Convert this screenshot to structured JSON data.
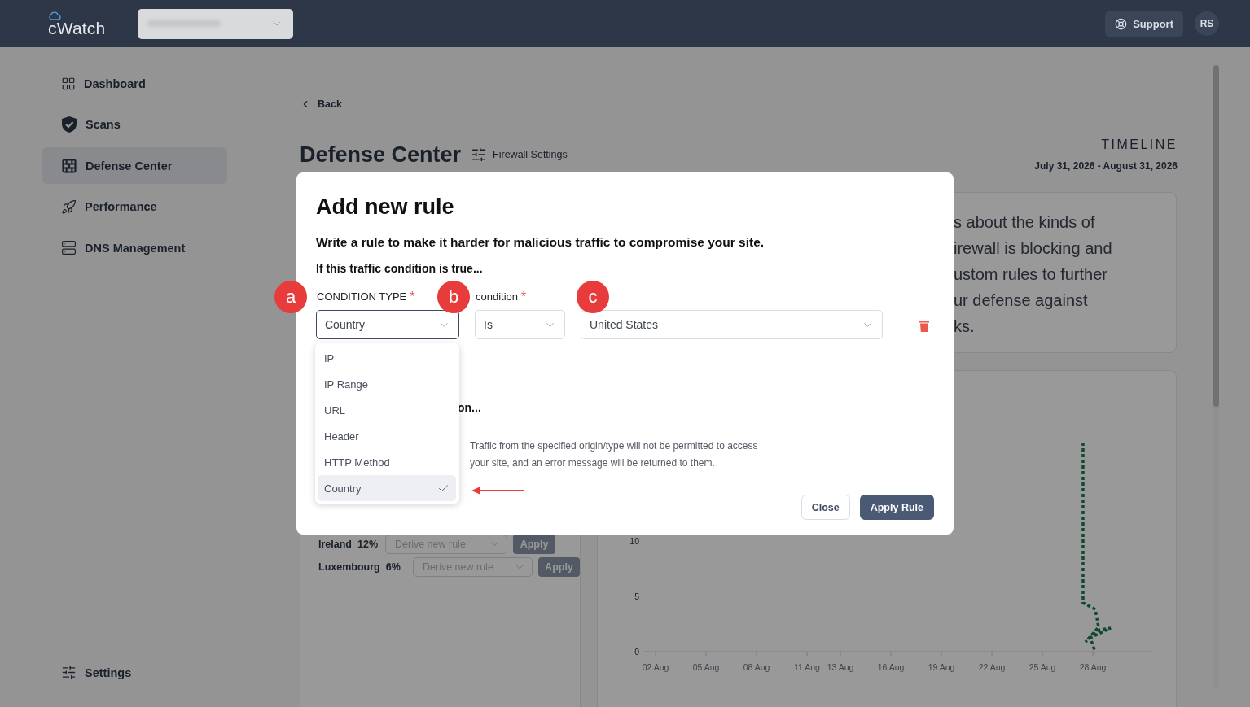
{
  "header": {
    "logo": "cWatch",
    "support_button": "Support",
    "avatar": "RS"
  },
  "sidebar": {
    "items": [
      {
        "label": "Dashboard",
        "selected": false
      },
      {
        "label": "Scans",
        "selected": false
      },
      {
        "label": "Defense Center",
        "selected": true
      },
      {
        "label": "Performance",
        "selected": false
      },
      {
        "label": "DNS Management",
        "selected": false
      }
    ],
    "footer_item": "Settings"
  },
  "page": {
    "back": "Back",
    "title": "Defense Center",
    "settings_link": "Firewall Settings",
    "timeline": {
      "label": "TIMELINE",
      "range": "July 31, 2026 - August 31, 2026"
    }
  },
  "info_card": {
    "lines": [
      "s about the kinds of",
      "irewall is blocking and",
      "ustom rules to further",
      "ur defense against",
      "ks."
    ]
  },
  "country_rules": [
    {
      "country": "Ireland",
      "share": "12%",
      "placeholder": "Derive new rule",
      "button": "Apply",
      "disabled": true
    },
    {
      "country": "Luxembourg",
      "share": "6%",
      "placeholder": "Derive new rule",
      "button": "Apply",
      "disabled": true
    }
  ],
  "chart": {
    "y_labels": [
      "10",
      "5",
      "0"
    ],
    "x_labels": [
      "02 Aug",
      "05 Aug",
      "08 Aug",
      "11 Aug",
      "13 Aug",
      "16 Aug",
      "19 Aug",
      "22 Aug",
      "25 Aug",
      "28 Aug"
    ]
  },
  "modal": {
    "title": "Add new rule",
    "subtitle": "Write a rule to make it harder for malicious traffic to compromise your site.",
    "condition_heading": "If this traffic condition is true...",
    "fields": [
      {
        "label": "CONDITION TYPE",
        "required_mark": "*",
        "value": "Country",
        "focused": true,
        "marker": "a"
      },
      {
        "label": "condition",
        "required_mark": "*",
        "value": "Is",
        "focused": false,
        "marker": "b"
      },
      {
        "value": "United States",
        "focused": false,
        "marker": "c"
      }
    ],
    "dropdown": {
      "options": [
        {
          "label": "IP",
          "selected": false
        },
        {
          "label": "IP Range",
          "selected": false
        },
        {
          "label": "URL",
          "selected": false
        },
        {
          "label": "Header",
          "selected": false
        },
        {
          "label": "HTTP Method",
          "selected": false
        },
        {
          "label": "Country",
          "selected": true
        }
      ]
    },
    "action_heading": "on...",
    "action_description": "Traffic from the specified origin/type will not be permitted to access your site, and an error message will be returned to them.",
    "buttons": {
      "close": "Close",
      "apply": "Apply Rule"
    }
  }
}
